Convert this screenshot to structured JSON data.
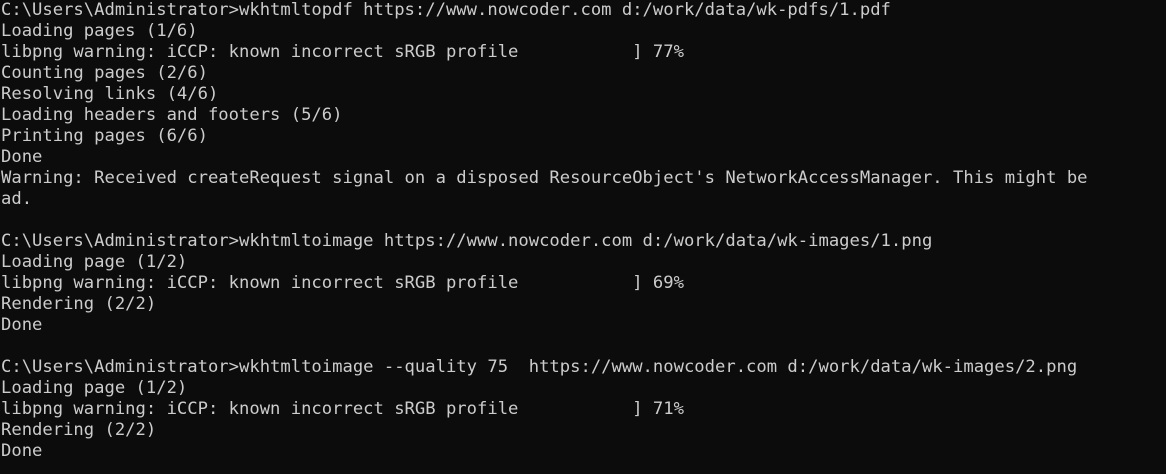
{
  "terminal": {
    "lines": [
      "C:\\Users\\Administrator>wkhtmltopdf https://www.nowcoder.com d:/work/data/wk-pdfs/1.pdf",
      "Loading pages (1/6)",
      "libpng warning: iCCP: known incorrect sRGB profile           ] 77%",
      "Counting pages (2/6)",
      "Resolving links (4/6)",
      "Loading headers and footers (5/6)",
      "Printing pages (6/6)",
      "Done",
      "Warning: Received createRequest signal on a disposed ResourceObject's NetworkAccessManager. This might be",
      "ad.",
      "",
      "C:\\Users\\Administrator>wkhtmltoimage https://www.nowcoder.com d:/work/data/wk-images/1.png",
      "Loading page (1/2)",
      "libpng warning: iCCP: known incorrect sRGB profile           ] 69%",
      "Rendering (2/2)",
      "Done",
      "",
      "C:\\Users\\Administrator>wkhtmltoimage --quality 75  https://www.nowcoder.com d:/work/data/wk-images/2.png",
      "Loading page (1/2)",
      "libpng warning: iCCP: known incorrect sRGB profile           ] 71%",
      "Rendering (2/2)",
      "Done"
    ]
  },
  "colors": {
    "background": "#0c0c0c",
    "foreground": "#cccccc"
  }
}
